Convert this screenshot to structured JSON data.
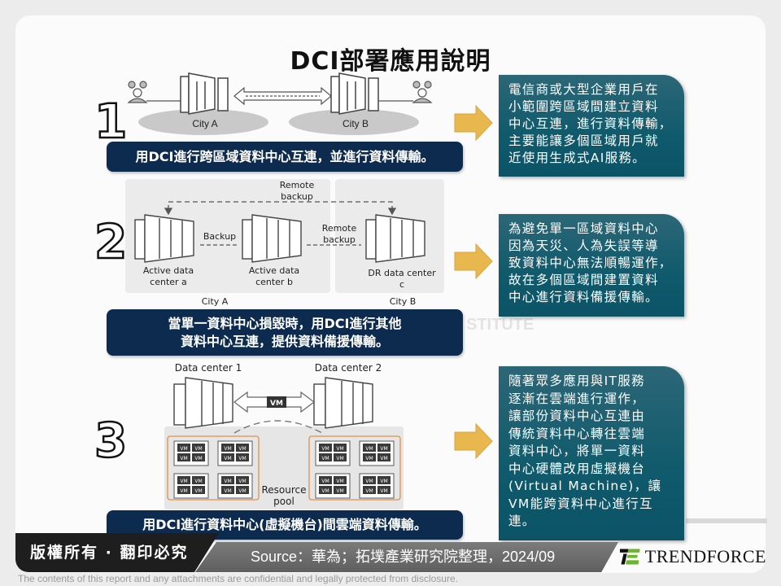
{
  "title": "DCI部署應用說明",
  "sections": [
    {
      "number": "1",
      "diagram": {
        "labels": [
          "City A",
          "City B"
        ]
      },
      "caption_lines": [
        "用DCI進行跨區域資料中心互連，並進行資料傳輸。"
      ],
      "note_lines": [
        "電信商或大型企業用戶在",
        "小範圍跨區域間建立資料",
        "中心互連，進行資料傳輸，",
        "主要能讓多個區域用戶就",
        "近使用生成式AI服務。"
      ]
    },
    {
      "number": "2",
      "diagram": {
        "remote_backup_top": [
          "Remote",
          "backup"
        ],
        "backup": "Backup",
        "remote_backup_mid": [
          "Remote",
          "backup"
        ],
        "dc_a": [
          "Active data",
          "center a"
        ],
        "dc_b": [
          "Active data",
          "center b"
        ],
        "dc_c": [
          "DR data center",
          "c"
        ],
        "city_a": "City A",
        "city_b": "City B"
      },
      "caption_lines": [
        "當單一資料中心損毀時，用DCI進行其他",
        "資料中心互連，提供資料備援傳輸。"
      ],
      "note_lines": [
        "為避免單一區域資料中心",
        "因為天災、人為失誤等導",
        "致資料中心無法順暢運作，",
        "故在多個區域間建置資料",
        "中心進行資料備援傳輸。"
      ]
    },
    {
      "number": "3",
      "diagram": {
        "dc1": "Data center 1",
        "dc2": "Data center 2",
        "vm": "VM",
        "pool": [
          "Resource",
          "pool"
        ]
      },
      "caption_lines": [
        "用DCI進行資料中心(虛擬機台)間雲端資料傳輸。"
      ],
      "note_lines": [
        "隨著眾多應用與IT服務",
        "逐漸在雲端進行運作，",
        "讓部份資料中心互連由",
        "傳統資料中心轉往雲端",
        "資料中心，將單一資料",
        "中心硬體改用虛擬機台",
        "(Virtual Machine)，讓",
        "VM能跨資料中心進行互",
        "連。"
      ]
    }
  ],
  "watermark": "STITUTE",
  "footer": {
    "copyright": "版權所有 · 翻印必究",
    "source": "Source：華為；拓墣產業研究院整理，2024/09",
    "logo": "TRENDFORCE",
    "disclaimer": "The contents of this report and any attachments are confidential and legally protected from disclosure."
  },
  "colors": {
    "caption_bg": "#0d2a4f",
    "note_bg": "#0f5a6c",
    "arrow": "#e8b84f",
    "logo_green": "#6bb52e"
  }
}
